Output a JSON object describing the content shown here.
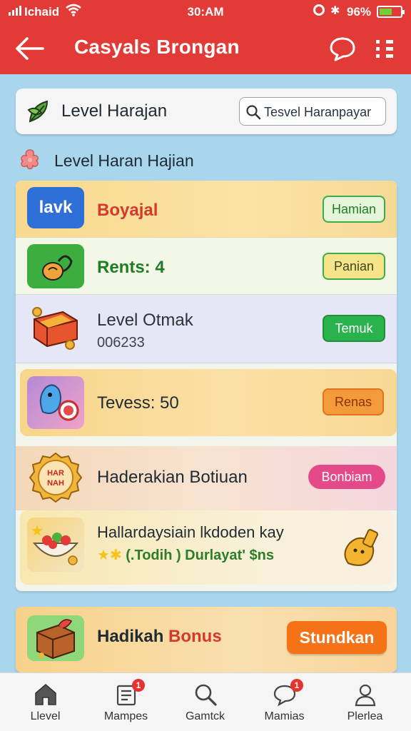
{
  "status_bar": {
    "carrier": "Ichaid",
    "time": "30:AM",
    "battery": "96%",
    "battery_level": 0.6
  },
  "app_bar": {
    "title": "Casyals Brongan",
    "icons": [
      "back-arrow-icon",
      "chat-bubble-icon",
      "menu-grid-icon"
    ]
  },
  "header_card": {
    "title": "Level Harajan",
    "search_value": "Tesvel Haranpayar"
  },
  "section": {
    "label": "Level Haran Hajian"
  },
  "rows": [
    {
      "badge_text": "lavk",
      "title": "Boyajal",
      "button": "Hamian",
      "title_color": "#d3392d",
      "badge_color": "#2f6fd8"
    },
    {
      "title": "Rents: 4",
      "button": "Panian",
      "title_color": "#1f7d28",
      "icon_color": "#3cae3f"
    },
    {
      "title": "Level Otmak",
      "subtitle": "006233",
      "button": "Temuk",
      "title_color": "#2a323a"
    },
    {
      "title": "Tevess: 50",
      "button": "Renas",
      "title_color": "#1f2a33"
    },
    {
      "icon_text": "HAR NAH",
      "title": "Haderakian Botiuan",
      "button": "Bonbiam",
      "title_color": "#1f2a33"
    },
    {
      "title": "Hallardaysiain lkdoden kay",
      "subtitle": "(.Todih ) Durlayat' $ns",
      "title_color": "#1f2a33"
    }
  ],
  "bonus": {
    "title_part1": "Hadikah ",
    "title_part2": "Bonus",
    "button": "Stundkan"
  },
  "nav": [
    {
      "label": "Llevel",
      "icon": "home-icon"
    },
    {
      "label": "Mampes",
      "icon": "list-icon",
      "badge": "1"
    },
    {
      "label": "Gamtck",
      "icon": "search-icon"
    },
    {
      "label": "Mamias",
      "icon": "chat-icon",
      "badge": "1"
    },
    {
      "label": "Plerlea",
      "icon": "profile-icon"
    }
  ],
  "colors": {
    "app_bar": "#e23a36",
    "background": "#a9d6ec",
    "button_green": "#2ab34d",
    "button_orange": "#f57316",
    "button_pink": "#e44a8a"
  }
}
